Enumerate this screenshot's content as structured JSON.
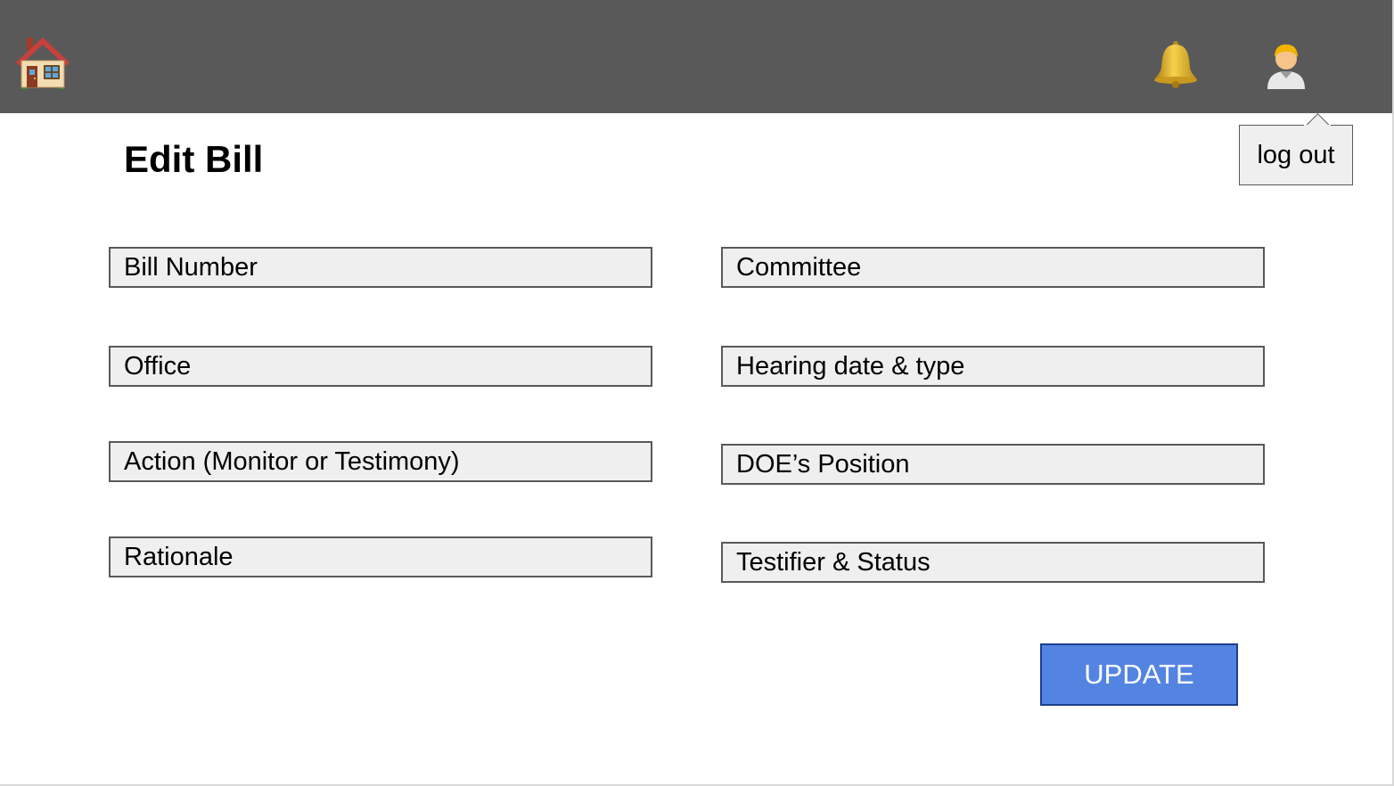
{
  "header": {
    "home_icon": "house-icon",
    "notification_icon": "bell-icon",
    "user_icon": "user-avatar-icon",
    "bar_color": "#595959"
  },
  "user_menu": {
    "logout_label": "log out"
  },
  "page": {
    "title": "Edit Bill"
  },
  "form": {
    "left_fields": [
      {
        "placeholder": "Bill Number",
        "value": ""
      },
      {
        "placeholder": "Office",
        "value": ""
      },
      {
        "placeholder": "Action (Monitor or Testimony)",
        "value": ""
      },
      {
        "placeholder": "Rationale",
        "value": ""
      }
    ],
    "right_fields": [
      {
        "placeholder": "Committee",
        "value": ""
      },
      {
        "placeholder": "Hearing date & type",
        "value": ""
      },
      {
        "placeholder": "DOE’s Position",
        "value": ""
      },
      {
        "placeholder": "Testifier & Status",
        "value": ""
      }
    ],
    "submit_label": "UPDATE",
    "submit_color": "#5484e1"
  }
}
